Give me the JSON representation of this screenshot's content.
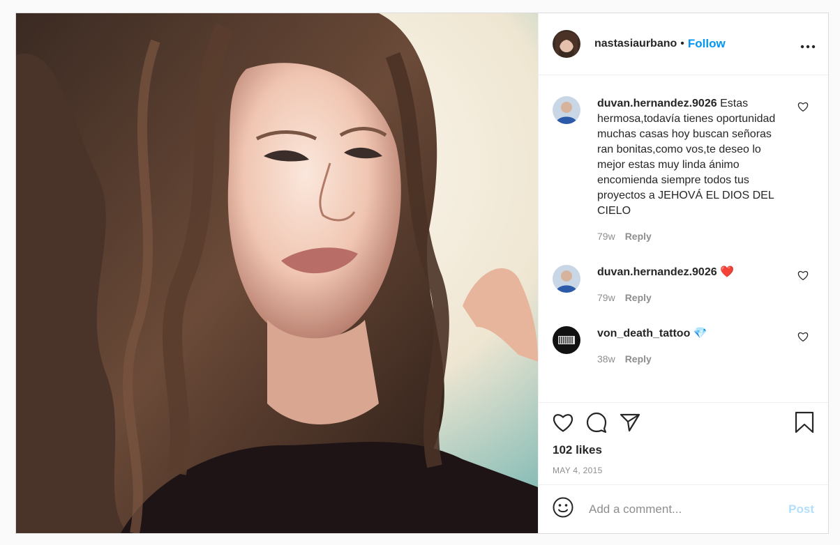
{
  "post": {
    "author": "nastasiaurbano",
    "dot": "•",
    "follow_label": "Follow",
    "more_label": "•••",
    "photo_alt": "Portrait photo",
    "likes": "102 likes",
    "date": "MAY 4, 2015",
    "add_comment_placeholder": "Add a comment...",
    "post_button": "Post"
  },
  "comments": [
    {
      "user": "duvan.hernandez.9026",
      "text": " Estas hermosa,todavía tienes oportunidad muchas casas hoy buscan señoras ran bonitas,como vos,te deseo lo mejor estas muy linda ánimo encomienda siempre todos tus proyectos a JEHOVÁ EL DIOS DEL CIELO",
      "age": "79w",
      "reply": "Reply"
    },
    {
      "user": "duvan.hernandez.9026",
      "text": " ❤️",
      "age": "79w",
      "reply": "Reply"
    },
    {
      "user": "von_death_tattoo",
      "text": " 💎",
      "age": "38w",
      "reply": "Reply"
    }
  ],
  "colors": {
    "link_blue": "#0095f6",
    "post_disabled": "#b2dffc",
    "muted": "#8e8e8e",
    "text": "#262626",
    "border": "#dbdbdb"
  },
  "icons": [
    "heart-icon",
    "comment-icon",
    "share-icon",
    "bookmark-icon",
    "smiley-icon",
    "more-icon"
  ]
}
